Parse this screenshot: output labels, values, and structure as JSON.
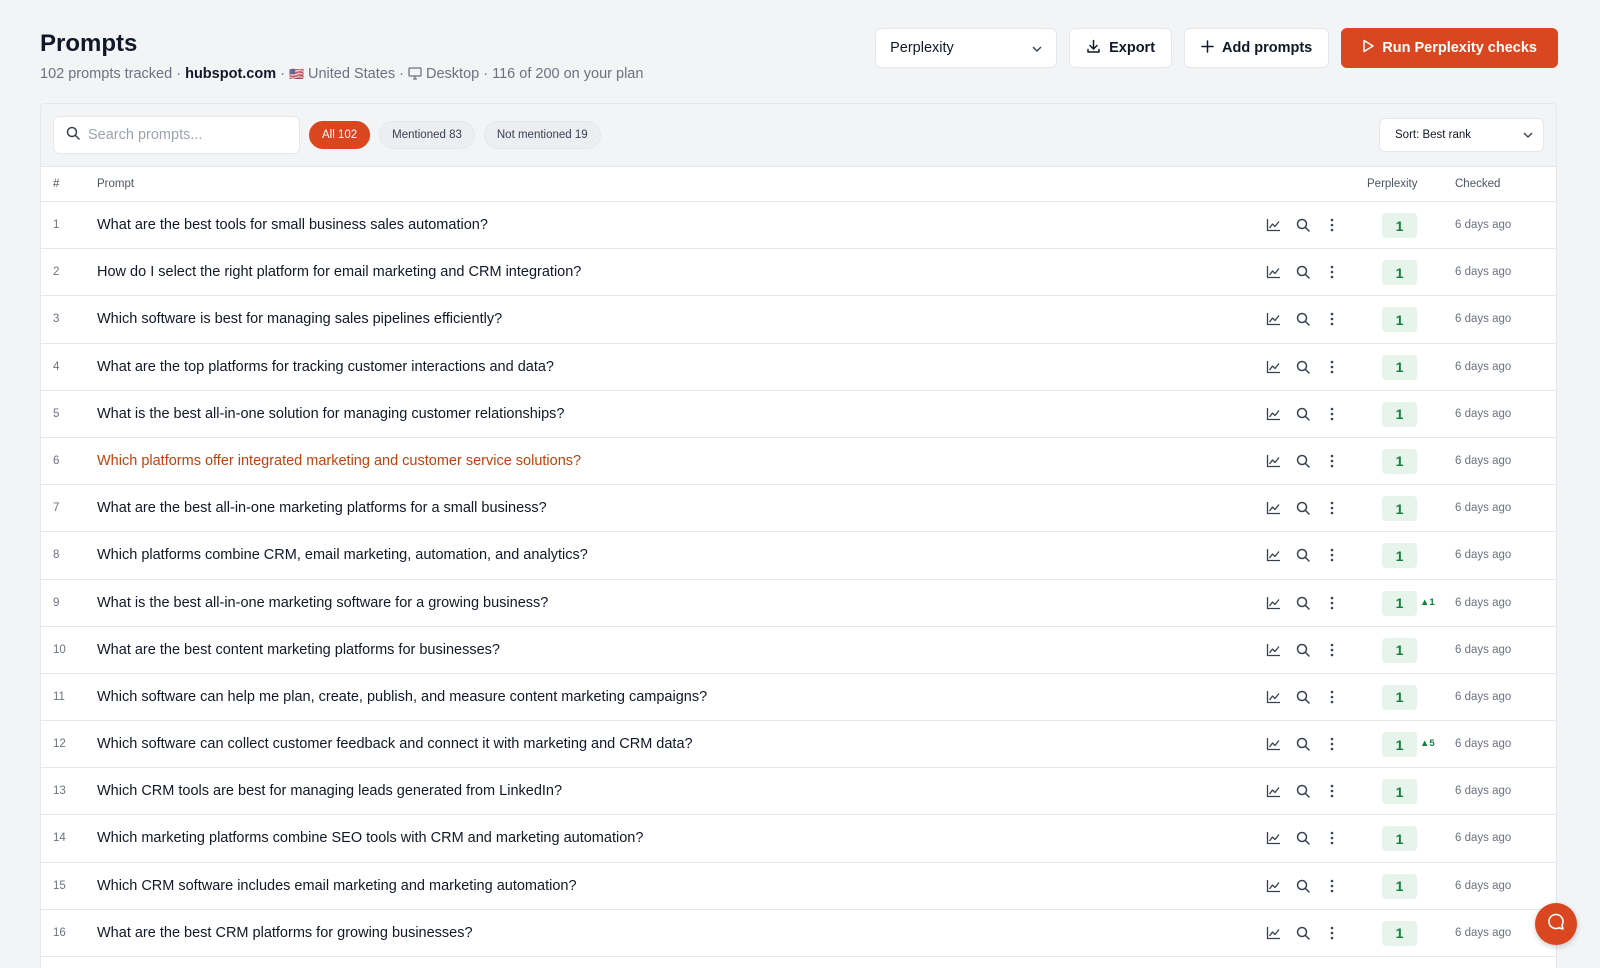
{
  "header": {
    "title": "Prompts",
    "tracked": "102 prompts tracked",
    "domain": "hubspot.com",
    "flag": "🇺🇸",
    "country": "United States",
    "device": "Desktop",
    "plan_usage": "116 of 200 on your plan",
    "separator": "·"
  },
  "actions": {
    "engine_select": "Perplexity",
    "export_label": "Export",
    "add_label": "Add prompts",
    "run_label": "Run Perplexity checks"
  },
  "toolbar": {
    "search_placeholder": "Search prompts...",
    "filters": [
      {
        "label": "All 102",
        "active": true
      },
      {
        "label": "Mentioned 83",
        "active": false
      },
      {
        "label": "Not mentioned 19",
        "active": false
      }
    ],
    "sort_label": "Sort: Best rank"
  },
  "table": {
    "columns": {
      "num": "#",
      "prompt": "Prompt",
      "engine": "Perplexity",
      "checked": "Checked"
    },
    "rows": [
      {
        "num": "1",
        "prompt": "What are the best tools for small business sales automation?",
        "rank": "1",
        "delta": "",
        "checked": "6 days ago"
      },
      {
        "num": "2",
        "prompt": "How do I select the right platform for email marketing and CRM integration?",
        "rank": "1",
        "delta": "",
        "checked": "6 days ago"
      },
      {
        "num": "3",
        "prompt": "Which software is best for managing sales pipelines efficiently?",
        "rank": "1",
        "delta": "",
        "checked": "6 days ago"
      },
      {
        "num": "4",
        "prompt": "What are the top platforms for tracking customer interactions and data?",
        "rank": "1",
        "delta": "",
        "checked": "6 days ago"
      },
      {
        "num": "5",
        "prompt": "What is the best all-in-one solution for managing customer relationships?",
        "rank": "1",
        "delta": "",
        "checked": "6 days ago"
      },
      {
        "num": "6",
        "prompt": "Which platforms offer integrated marketing and customer service solutions?",
        "rank": "1",
        "delta": "",
        "checked": "6 days ago",
        "highlight": true
      },
      {
        "num": "7",
        "prompt": "What are the best all-in-one marketing platforms for a small business?",
        "rank": "1",
        "delta": "",
        "checked": "6 days ago"
      },
      {
        "num": "8",
        "prompt": "Which platforms combine CRM, email marketing, automation, and analytics?",
        "rank": "1",
        "delta": "",
        "checked": "6 days ago"
      },
      {
        "num": "9",
        "prompt": "What is the best all-in-one marketing software for a growing business?",
        "rank": "1",
        "delta": "▲1",
        "checked": "6 days ago"
      },
      {
        "num": "10",
        "prompt": "What are the best content marketing platforms for businesses?",
        "rank": "1",
        "delta": "",
        "checked": "6 days ago"
      },
      {
        "num": "11",
        "prompt": "Which software can help me plan, create, publish, and measure content marketing campaigns?",
        "rank": "1",
        "delta": "",
        "checked": "6 days ago"
      },
      {
        "num": "12",
        "prompt": "Which software can collect customer feedback and connect it with marketing and CRM data?",
        "rank": "1",
        "delta": "▲5",
        "checked": "6 days ago"
      },
      {
        "num": "13",
        "prompt": "Which CRM tools are best for managing leads generated from LinkedIn?",
        "rank": "1",
        "delta": "",
        "checked": "6 days ago"
      },
      {
        "num": "14",
        "prompt": "Which marketing platforms combine SEO tools with CRM and marketing automation?",
        "rank": "1",
        "delta": "",
        "checked": "6 days ago"
      },
      {
        "num": "15",
        "prompt": "Which CRM software includes email marketing and marketing automation?",
        "rank": "1",
        "delta": "",
        "checked": "6 days ago"
      },
      {
        "num": "16",
        "prompt": "What are the best CRM platforms for growing businesses?",
        "rank": "1",
        "delta": "",
        "checked": "6 days ago"
      }
    ]
  },
  "colors": {
    "accent": "#d9461f",
    "rank_bg": "#e6f4ec",
    "rank_text": "#15803d",
    "highlight_text": "#c2410c"
  },
  "icons": {
    "row_actions": [
      "chart-icon",
      "search-icon",
      "more-vertical-icon"
    ],
    "chat": "chat-bubble-icon"
  }
}
